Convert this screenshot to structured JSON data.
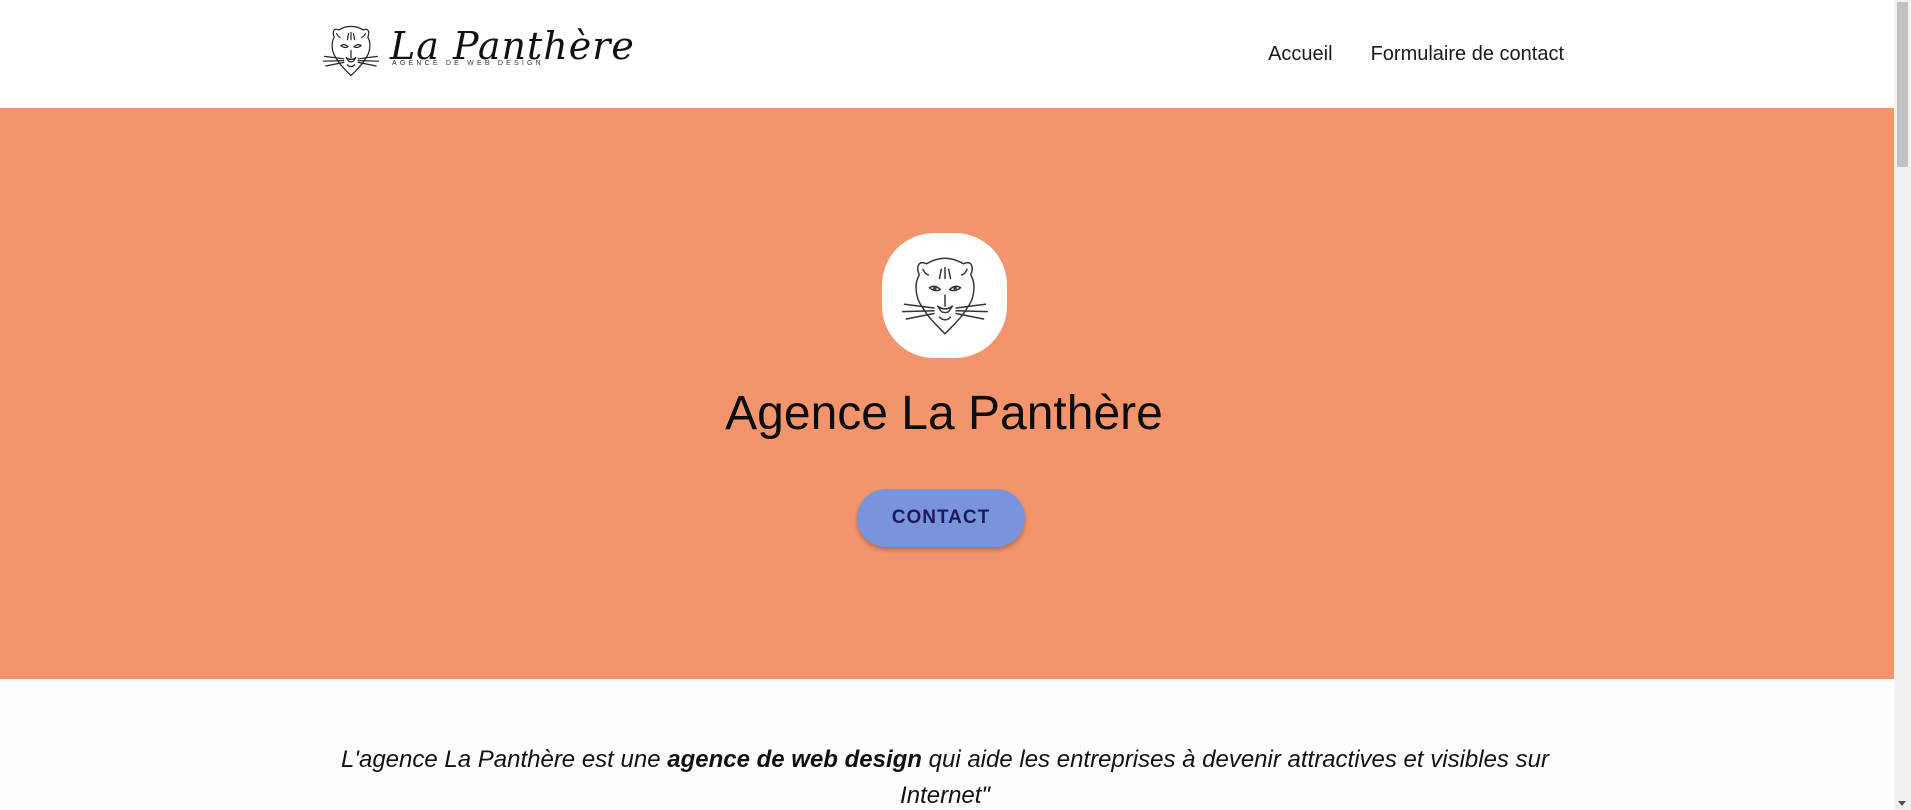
{
  "header": {
    "logo": {
      "name": "La Panthère",
      "tagline": "AGENCE DE WEB DESIGN",
      "icon": "panther-head-icon"
    },
    "nav": [
      {
        "label": "Accueil"
      },
      {
        "label": "Formulaire de contact"
      }
    ]
  },
  "hero": {
    "icon": "panther-head-icon",
    "title": "Agence La Panthère",
    "button_label": "CONTACT"
  },
  "intro": {
    "part1": "L'agence La Panthère est une ",
    "bold": "agence de web design",
    "part2": " qui aide les entreprises à devenir attractives et visibles sur Internet\""
  },
  "colors": {
    "hero_background": "#f2956c",
    "button_background": "#7a94dc",
    "button_text": "#1d1a5a",
    "page_background": "#ffffff"
  }
}
